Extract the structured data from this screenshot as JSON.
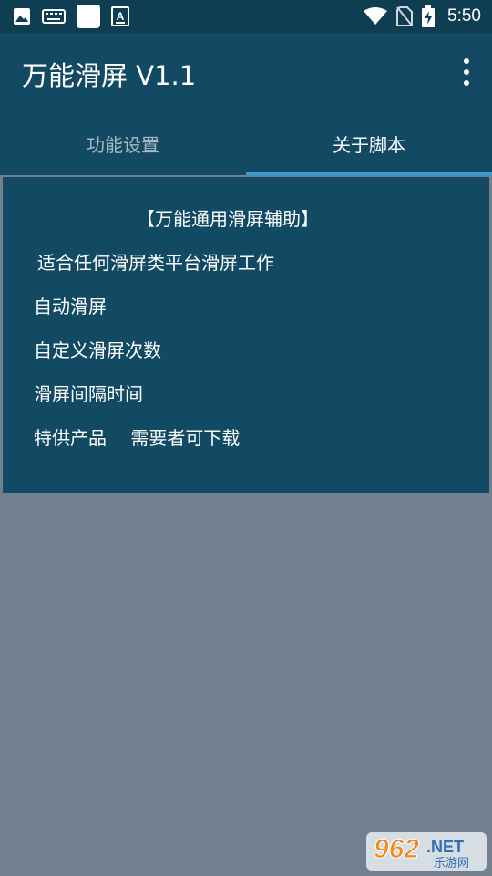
{
  "status_bar": {
    "icons": [
      "image-icon",
      "keyboard-icon",
      "app-icon",
      "font-icon",
      "wifi-icon",
      "no-sim-icon",
      "battery-charging-icon"
    ],
    "time": "5:50"
  },
  "app_bar": {
    "title": "万能滑屏 V1.1",
    "menu_icon": "more-vertical-icon"
  },
  "tabs": [
    {
      "label": "功能设置",
      "selected": false
    },
    {
      "label": "关于脚本",
      "selected": true
    }
  ],
  "about": {
    "heading": "【万能通用滑屏辅助】",
    "lines": [
      "适合任何滑屏类平台滑屏工作",
      "自动滑屏",
      "自定义滑屏次数",
      "滑屏间隔时间",
      "特供产品　 需要者可下载"
    ]
  },
  "watermark": {
    "number": "962",
    "suffix": ".NET",
    "sub": "乐游网"
  },
  "colors": {
    "status_bar": "#0f3d52",
    "app_bar": "#124a63",
    "tab_indicator": "#29a3d9",
    "background": "#717f8e"
  }
}
